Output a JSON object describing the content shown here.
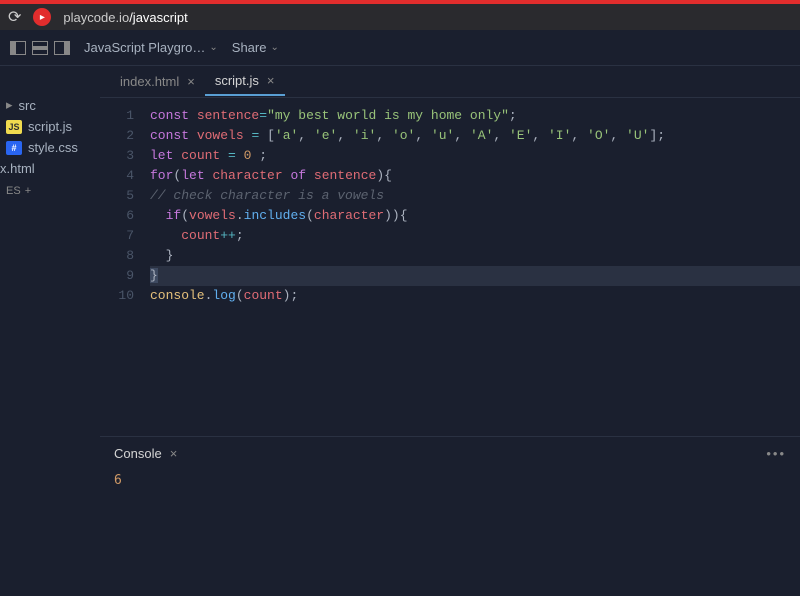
{
  "browser": {
    "host": "playcode.io",
    "path": "/javascript"
  },
  "toolbar": {
    "project_name": "JavaScript Playgro…",
    "share_label": "Share"
  },
  "sidebar": {
    "folder": "src",
    "files": [
      {
        "name": "script.js",
        "type": "js"
      },
      {
        "name": "style.css",
        "type": "css"
      },
      {
        "name": "x.html",
        "type": "html"
      }
    ],
    "packages_label": "ES",
    "packages_plus": "+"
  },
  "tabs": [
    {
      "label": "index.html",
      "active": false
    },
    {
      "label": "script.js",
      "active": true
    }
  ],
  "code": {
    "line_count": 10,
    "lines_plain": [
      "const sentence=\"my best world is my home only\";",
      "const vowels = ['a', 'e', 'i', 'o', 'u', 'A', 'E', 'I', 'O', 'U'];",
      "let count = 0 ;",
      "for(let character of sentence){",
      "// check character is a vowels",
      "  if(vowels.includes(character)){",
      "    count++;",
      "  }",
      "}",
      "console.log(count);"
    ]
  },
  "console": {
    "title": "Console",
    "output": "6"
  }
}
